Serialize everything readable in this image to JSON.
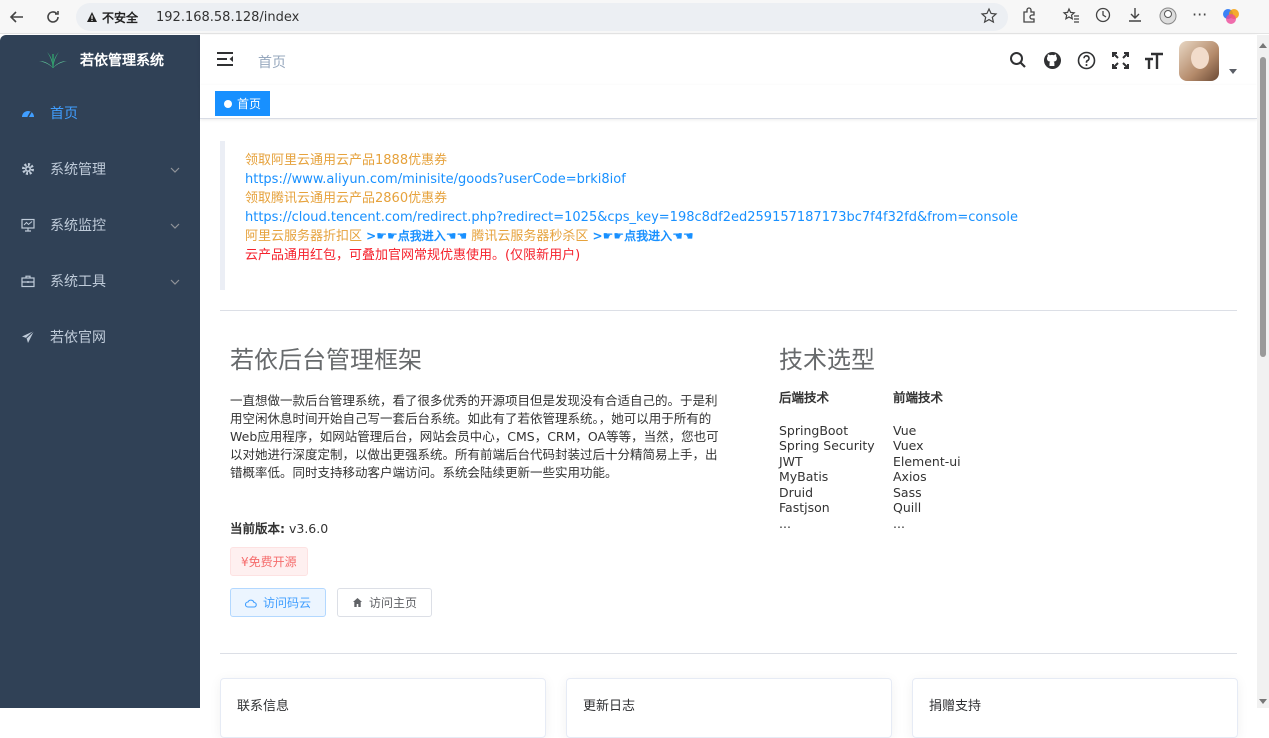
{
  "browser": {
    "security_label": "不安全",
    "url": "192.168.58.128/index"
  },
  "sidebar": {
    "title": "若依管理系统",
    "items": [
      {
        "label": "首页",
        "icon": "dashboard-icon"
      },
      {
        "label": "系统管理",
        "icon": "gear-icon"
      },
      {
        "label": "系统监控",
        "icon": "monitor-icon"
      },
      {
        "label": "系统工具",
        "icon": "toolbox-icon"
      },
      {
        "label": "若依官网",
        "icon": "paper-plane-icon"
      }
    ]
  },
  "header": {
    "breadcrumb": "首页"
  },
  "tags": {
    "active": "首页"
  },
  "notice": {
    "line1": "领取阿里云通用云产品1888优惠券",
    "link1": "https://www.aliyun.com/minisite/goods?userCode=brki8iof",
    "line2": "领取腾讯云通用云产品2860优惠券",
    "link2": "https://cloud.tencent.com/redirect.php?redirect=1025&cps_key=198c8df2ed259157187173bc7f4f32fd&from=console",
    "ali_zone": "阿里云服务器折扣区",
    "go1": ">☛☛点我进入☚☚",
    "tx_zone": "腾讯云服务器秒杀区",
    "go2": ">☛☛点我进入☚☚",
    "red_line": "云产品通用红包，可叠加官网常规优惠使用。(仅限新用户)"
  },
  "intro": {
    "title": "若依后台管理框架",
    "description": "一直想做一款后台管理系统，看了很多优秀的开源项目但是发现没有合适自己的。于是利用空闲休息时间开始自己写一套后台系统。如此有了若依管理系统。，她可以用于所有的Web应用程序，如网站管理后台，网站会员中心，CMS，CRM，OA等等，当然，您也可以对她进行深度定制，以做出更强系统。所有前端后台代码封装过后十分精简易上手，出错概率低。同时支持移动客户端访问。系统会陆续更新一些实用功能。",
    "version_label": "当前版本:",
    "version_value": "v3.6.0",
    "free_tag": "¥免费开源",
    "btn_gitee": "访问码云",
    "btn_home": "访问主页"
  },
  "tech": {
    "title": "技术选型",
    "backend_header": "后端技术",
    "frontend_header": "前端技术",
    "backend": [
      "SpringBoot",
      "Spring Security",
      "JWT",
      "MyBatis",
      "Druid",
      "Fastjson",
      "..."
    ],
    "frontend": [
      "Vue",
      "Vuex",
      "Element-ui",
      "Axios",
      "Sass",
      "Quill",
      "..."
    ]
  },
  "cards": [
    {
      "title": "联系信息"
    },
    {
      "title": "更新日志"
    },
    {
      "title": "捐赠支持"
    }
  ]
}
